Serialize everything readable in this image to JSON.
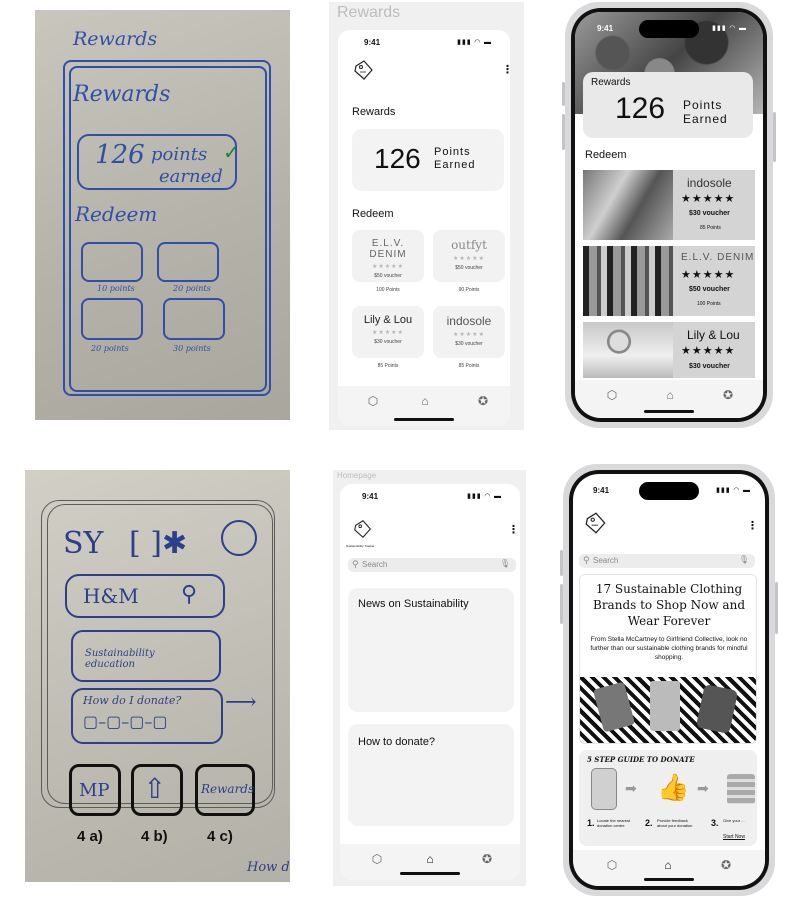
{
  "status": {
    "time": "9:41"
  },
  "stars": "★★★★★",
  "sketch_rewards": {
    "header": "Rewards",
    "title": "Rewards",
    "points_num": "126",
    "points_word": "points",
    "points_word2": "earned",
    "redeem": "Redeem",
    "tile_labels": [
      "10 points",
      "20 points",
      "20 points",
      "30 points"
    ]
  },
  "wf_rewards": {
    "frame_title": "Rewards",
    "section_title": "Rewards",
    "points_value": "126",
    "points_label_1": "Points",
    "points_label_2": "Earned",
    "redeem_title": "Redeem",
    "cards": [
      {
        "brand": "E.L.V. DENIM",
        "voucher": "$50 voucher",
        "points": "100 Points"
      },
      {
        "brand": "outfyt",
        "voucher": "$50 voucher",
        "points": "90 Points"
      },
      {
        "brand": "Lily & Lou",
        "voucher": "$30 voucher",
        "points": "85 Points"
      },
      {
        "brand": "indosole",
        "voucher": "$30 voucher",
        "points": "85 Points"
      }
    ]
  },
  "hf_rewards": {
    "section_title": "Rewards",
    "points_value": "126",
    "points_label_1": "Points",
    "points_label_2": "Earned",
    "redeem_title": "Redeem",
    "cards": [
      {
        "brand": "indosole",
        "voucher": "$30 voucher",
        "points": "85 Points"
      },
      {
        "brand": "E.L.V. DENIM",
        "voucher": "$50 voucher",
        "points": "100 Points"
      },
      {
        "brand": "Lily & Lou",
        "voucher": "$30 voucher"
      }
    ]
  },
  "sketch_home": {
    "logo": "SY",
    "search_text": "H&M",
    "edu": "Sustainability education",
    "donate": "How do I donate?",
    "tab_mp": "MP",
    "tab_rewards": "Rewards",
    "labels": [
      "4 a)",
      "4 b)",
      "4 c)"
    ],
    "how_do": "How do"
  },
  "wf_home": {
    "frame_title": "Homepage",
    "logo_caption": "Sustainability Tracker",
    "search_placeholder": "Search",
    "news_title": "News on Sustainability",
    "donate_title": "How to donate?"
  },
  "hf_home": {
    "search_placeholder": "Search",
    "article_title": "17 Sustainable Clothing Brands to Shop Now and Wear Forever",
    "article_body": "From Stella McCartney to Girlfriend Collective, look no further than our sustainable clothing brands for mindful shopping.",
    "guide_title": "5 STEP GUIDE TO DONATE",
    "steps": [
      {
        "num": "1.",
        "text": "Locate the nearest donation centre"
      },
      {
        "num": "2.",
        "text": "Provide feedback about your donation"
      },
      {
        "num": "3.",
        "text": "Give your ..."
      }
    ],
    "start_now": "Start Now"
  }
}
